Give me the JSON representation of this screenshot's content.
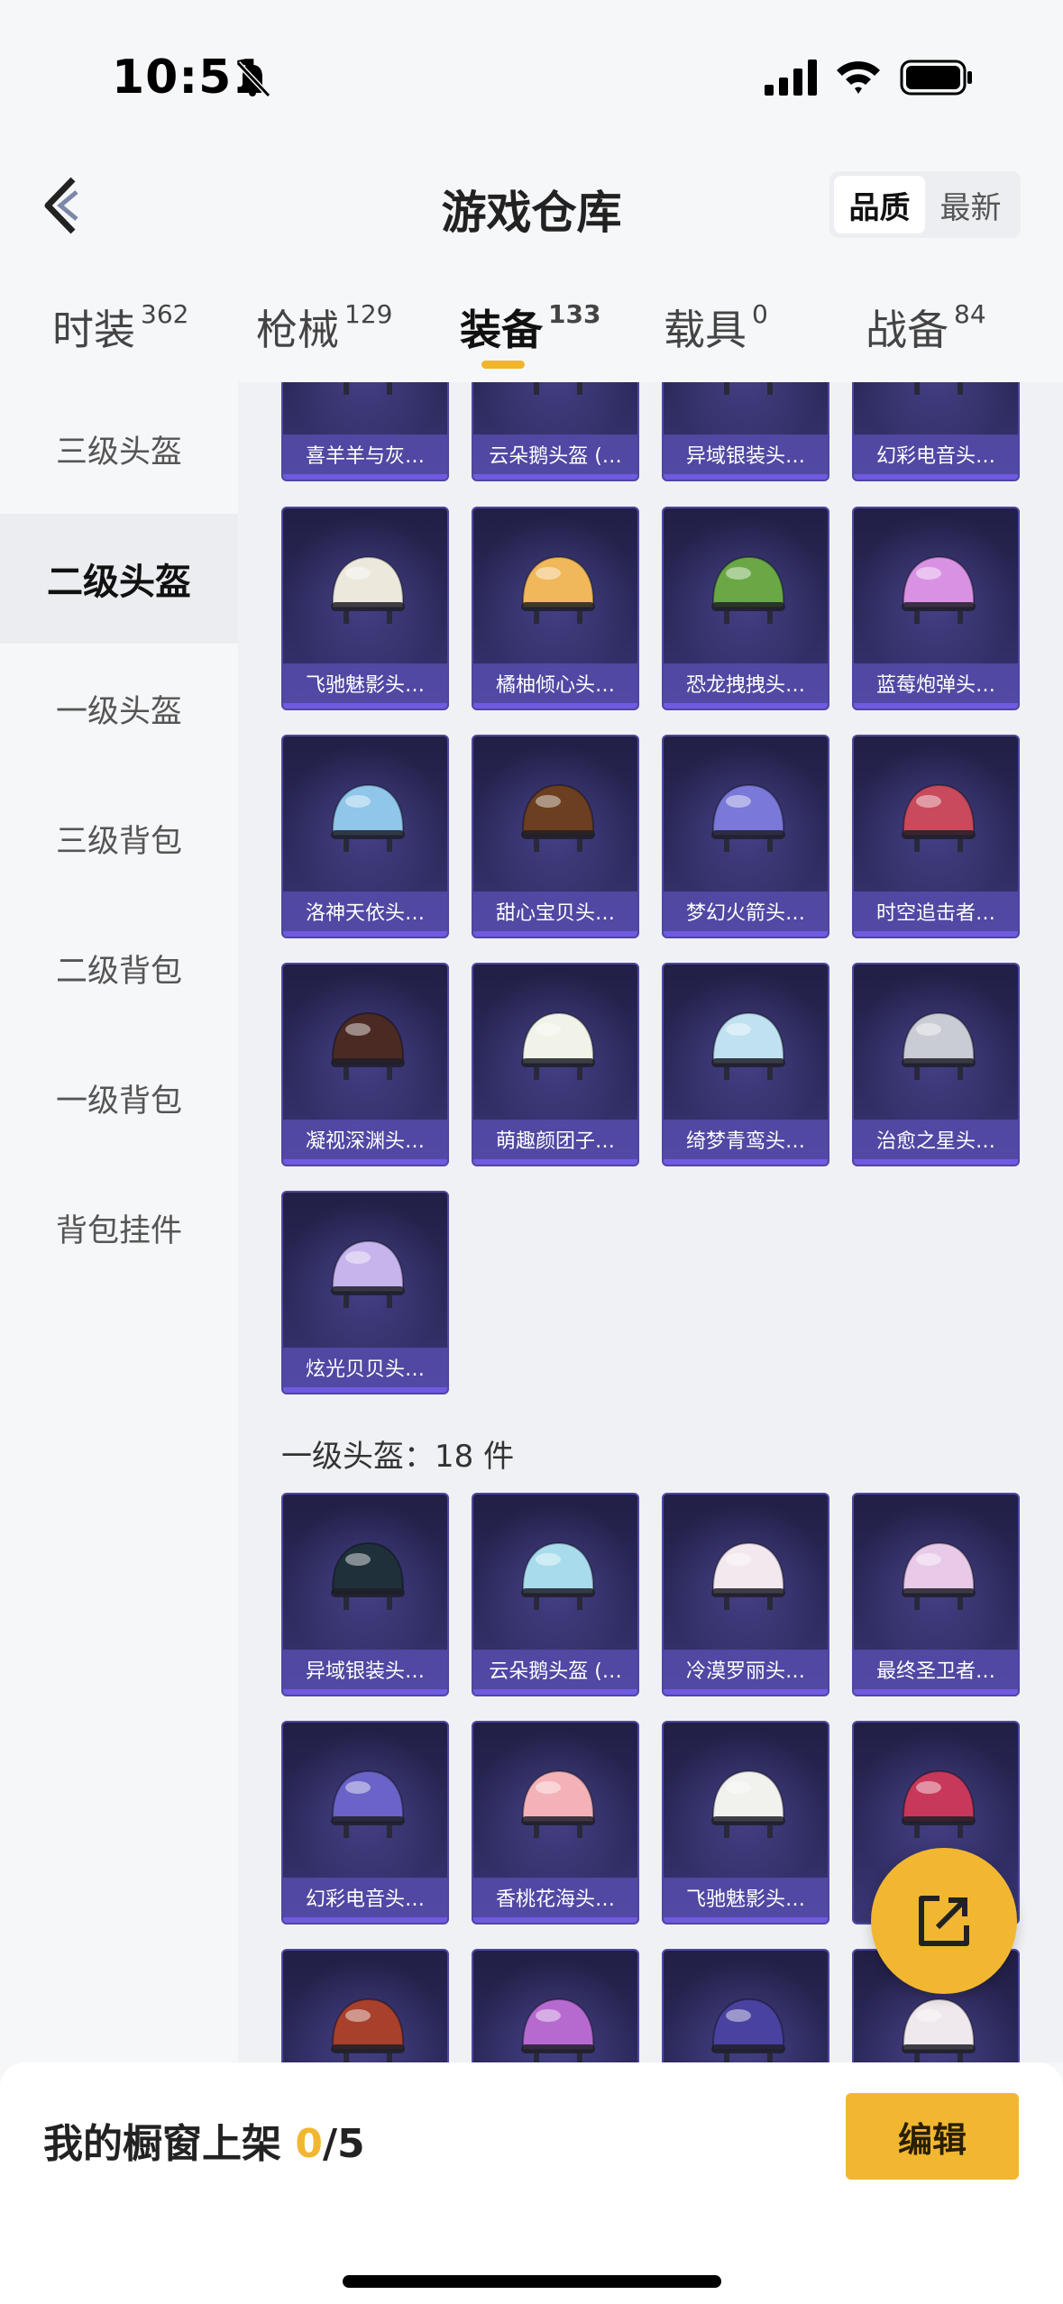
{
  "status": {
    "time": "10:51"
  },
  "header": {
    "title": "游戏仓库",
    "sort_options": [
      "品质",
      "最新"
    ]
  },
  "tabs": [
    {
      "label": "时装",
      "count": "362"
    },
    {
      "label": "枪械",
      "count": "129"
    },
    {
      "label": "装备",
      "count": "133"
    },
    {
      "label": "载具",
      "count": "0"
    },
    {
      "label": "战备",
      "count": "84"
    }
  ],
  "sidebar": [
    "三级头盔",
    "二级头盔",
    "一级头盔",
    "三级背包",
    "二级背包",
    "一级背包",
    "背包挂件"
  ],
  "colors": {
    "accent": "#f1b731",
    "card_bg": "#2c2a5c",
    "card_label": "#6054be"
  },
  "level2_cards": [
    {
      "label": "喜羊羊与灰…",
      "icon": "sheep-costume-icon",
      "color": "#f2c6d0"
    },
    {
      "label": "云朵鹅头盔 (…",
      "icon": "goose-helmet-icon",
      "color": "#f3e6a8"
    },
    {
      "label": "异域银装头…",
      "icon": "silver-helmet-icon",
      "color": "#2b3b48"
    },
    {
      "label": "幻彩电音头…",
      "icon": "music-helmet-icon",
      "color": "#5a4c8c"
    },
    {
      "label": "飞驰魅影头…",
      "icon": "white-gold-helmet-icon",
      "color": "#ece8dc"
    },
    {
      "label": "橘柚倾心头…",
      "icon": "orange-helmet-icon",
      "color": "#f0b85a"
    },
    {
      "label": "恐龙拽拽头…",
      "icon": "frog-helmet-icon",
      "color": "#6aa845"
    },
    {
      "label": "蓝莓炮弹头…",
      "icon": "pink-helmet-icon",
      "color": "#d992e3"
    },
    {
      "label": "洛神天依头…",
      "icon": "blue-ribbon-helmet-icon",
      "color": "#8fc6ea"
    },
    {
      "label": "甜心宝贝头…",
      "icon": "chocolate-helmet-icon",
      "color": "#6b3f20"
    },
    {
      "label": "梦幻火箭头…",
      "icon": "rocket-helmet-icon",
      "color": "#7a78d8"
    },
    {
      "label": "时空追击者…",
      "icon": "red-helmet-icon",
      "color": "#c94a5c"
    },
    {
      "label": "凝视深渊头…",
      "icon": "dark-wing-helmet-icon",
      "color": "#4a2a22"
    },
    {
      "label": "萌趣颜团子…",
      "icon": "dumpling-helmet-icon",
      "color": "#f1f3e8"
    },
    {
      "label": "绮梦青鸾头…",
      "icon": "bird-helmet-icon",
      "color": "#bfe1f0"
    },
    {
      "label": "治愈之星头…",
      "icon": "visor-helmet-icon",
      "color": "#c9ccd4"
    },
    {
      "label": "炫光贝贝头…",
      "icon": "shell-helmet-icon",
      "color": "#c7b4ec"
    }
  ],
  "level1_title": "一级头盔：18 件",
  "level1_cards": [
    {
      "label": "异域银装头…",
      "icon": "silver-helmet-icon",
      "color": "#20303a"
    },
    {
      "label": "云朵鹅头盔 (…",
      "icon": "goose-helmet-icon",
      "color": "#a8dcec"
    },
    {
      "label": "冷漠罗丽头…",
      "icon": "pink-white-helmet-icon",
      "color": "#f3e8ee"
    },
    {
      "label": "最终圣卫者…",
      "icon": "crystal-helmet-icon",
      "color": "#e8c9e8"
    },
    {
      "label": "幻彩电音头…",
      "icon": "music-helmet-icon",
      "color": "#6a63c8"
    },
    {
      "label": "香桃花海头…",
      "icon": "peach-helmet-icon",
      "color": "#f4b2b8"
    },
    {
      "label": "飞驰魅影头…",
      "icon": "white-gold-helmet-icon",
      "color": "#f1f1ee"
    },
    {
      "label": "",
      "icon": "cat-ear-helmet-icon",
      "color": "#c8385a"
    },
    {
      "label": "",
      "icon": "red-cap-helmet-icon",
      "color": "#a8402c"
    },
    {
      "label": "",
      "icon": "purple-helmet-icon",
      "color": "#b66ad0"
    },
    {
      "label": "",
      "icon": "galaxy-helmet-icon",
      "color": "#4a42a0"
    },
    {
      "label": "",
      "icon": "white-pink-helmet-icon",
      "color": "#efe8ec"
    }
  ],
  "fab": {
    "icon": "share-icon"
  },
  "bottom": {
    "shelf_label": "我的橱窗上架 ",
    "shelf_used": "0",
    "shelf_total": "/5",
    "edit_label": "编辑"
  }
}
